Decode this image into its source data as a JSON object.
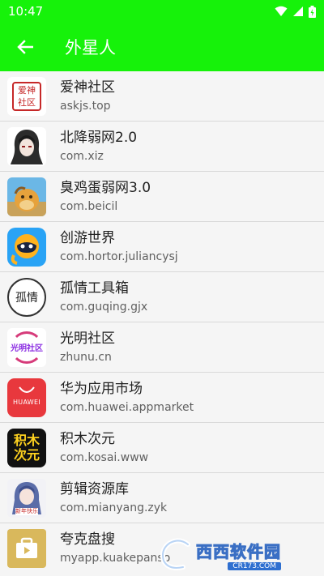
{
  "status": {
    "time": "10:47"
  },
  "appbar": {
    "title": "外星人"
  },
  "items": [
    {
      "name": "爱神社区",
      "pkg": "askjs.top",
      "icon": "aishen-seal-icon"
    },
    {
      "name": "北降弱网2.0",
      "pkg": "com.xiz",
      "icon": "hooded-figure-icon"
    },
    {
      "name": "臭鸡蛋弱网3.0",
      "pkg": "com.beicil",
      "icon": "cartoon-character-icon"
    },
    {
      "name": "创游世界",
      "pkg": "com.hortor.juliancysj",
      "icon": "chuangyou-robot-icon"
    },
    {
      "name": "孤情工具箱",
      "pkg": "com.guqing.gjx",
      "icon": "guqing-calligraphy-icon"
    },
    {
      "name": "光明社区",
      "pkg": "zhunu.cn",
      "icon": "guangming-logo-icon"
    },
    {
      "name": "华为应用市场",
      "pkg": "com.huawei.appmarket",
      "icon": "huawei-appgallery-icon"
    },
    {
      "name": "积木次元",
      "pkg": "com.kosai.www",
      "icon": "jimu-logo-icon"
    },
    {
      "name": "剪辑资源库",
      "pkg": "com.mianyang.zyk",
      "icon": "anime-girl-icon"
    },
    {
      "name": "夸克盘搜",
      "pkg": "myapp.kuakepanso",
      "icon": "quark-briefcase-icon"
    }
  ],
  "icon_text": {
    "aishen_top": "爱神",
    "aishen_bottom": "社区",
    "guqing": "孤情",
    "guangming": "光明社区",
    "huawei": "HUAWEI",
    "jimu_top": "积木",
    "jimu_bottom": "次元",
    "anime_caption": "新年快乐"
  },
  "watermark": {
    "brand": "西西软件园",
    "site": "CR173.COM"
  },
  "colors": {
    "accent": "#16f20a",
    "huawei": "#e8383d",
    "chuangyou": "#29a3f5"
  }
}
